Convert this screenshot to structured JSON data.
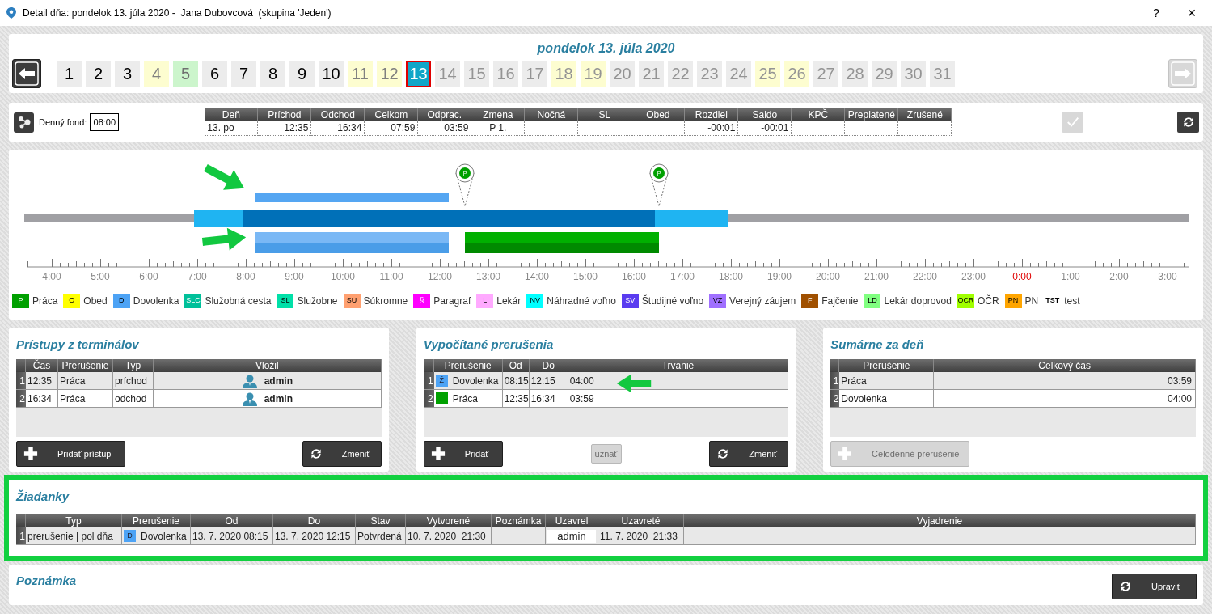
{
  "window": {
    "title": "Detail dňa: pondelok 13. júla 2020 -  Jana Dubovcová  (skupina 'Jeden')",
    "help": "?",
    "close": "×"
  },
  "date_heading": "pondelok 13. júla 2020",
  "nav": {
    "prev_disabled": false,
    "next_disabled": true
  },
  "days": [
    {
      "label": "1",
      "kind": "work",
      "future": false,
      "selected": false
    },
    {
      "label": "2",
      "kind": "work",
      "future": false,
      "selected": false
    },
    {
      "label": "3",
      "kind": "work",
      "future": false,
      "selected": false
    },
    {
      "label": "4",
      "kind": "weekend",
      "future": false,
      "selected": false
    },
    {
      "label": "5",
      "kind": "holiday",
      "future": false,
      "selected": false
    },
    {
      "label": "6",
      "kind": "work",
      "future": false,
      "selected": false
    },
    {
      "label": "7",
      "kind": "work",
      "future": false,
      "selected": false
    },
    {
      "label": "8",
      "kind": "work",
      "future": false,
      "selected": false
    },
    {
      "label": "9",
      "kind": "work",
      "future": false,
      "selected": false
    },
    {
      "label": "10",
      "kind": "work",
      "future": false,
      "selected": false
    },
    {
      "label": "11",
      "kind": "weekend",
      "future": false,
      "selected": false
    },
    {
      "label": "12",
      "kind": "weekend",
      "future": false,
      "selected": false
    },
    {
      "label": "13",
      "selected": true
    },
    {
      "label": "14",
      "kind": "work",
      "future": true,
      "selected": false
    },
    {
      "label": "15",
      "kind": "work",
      "future": true,
      "selected": false
    },
    {
      "label": "16",
      "kind": "work",
      "future": true,
      "selected": false
    },
    {
      "label": "17",
      "kind": "work",
      "future": true,
      "selected": false
    },
    {
      "label": "18",
      "kind": "weekend",
      "future": true,
      "selected": false
    },
    {
      "label": "19",
      "kind": "weekend",
      "future": true,
      "selected": false
    },
    {
      "label": "20",
      "kind": "work",
      "future": true,
      "selected": false
    },
    {
      "label": "21",
      "kind": "work",
      "future": true,
      "selected": false
    },
    {
      "label": "22",
      "kind": "work",
      "future": true,
      "selected": false
    },
    {
      "label": "23",
      "kind": "work",
      "future": true,
      "selected": false
    },
    {
      "label": "24",
      "kind": "work",
      "future": true,
      "selected": false
    },
    {
      "label": "25",
      "kind": "weekend",
      "future": true,
      "selected": false
    },
    {
      "label": "26",
      "kind": "weekend",
      "future": true,
      "selected": false
    },
    {
      "label": "27",
      "kind": "work",
      "future": true,
      "selected": false
    },
    {
      "label": "28",
      "kind": "work",
      "future": true,
      "selected": false
    },
    {
      "label": "29",
      "kind": "work",
      "future": true,
      "selected": false
    },
    {
      "label": "30",
      "kind": "work",
      "future": true,
      "selected": false
    },
    {
      "label": "31",
      "kind": "work",
      "future": true,
      "selected": false
    }
  ],
  "day_fund": {
    "label": "Denný fond:",
    "value": "08:00"
  },
  "summary": {
    "columns": [
      {
        "label": "Deň",
        "value": "13. po"
      },
      {
        "label": "Príchod",
        "value": "12:35"
      },
      {
        "label": "Odchod",
        "value": "16:34"
      },
      {
        "label": "Celkom",
        "value": "07:59"
      },
      {
        "label": "Odprac.",
        "value": "03:59"
      },
      {
        "label": "Zmena",
        "value": "P 1."
      },
      {
        "label": "Nočná"
      },
      {
        "label": "SL"
      },
      {
        "label": "Obed"
      },
      {
        "label": "Rozdiel",
        "value": "-00:01"
      },
      {
        "label": "Saldo",
        "value": "-00:01"
      },
      {
        "label": "KPČ"
      },
      {
        "label": "Preplatené"
      },
      {
        "label": "Zrušené"
      }
    ]
  },
  "confirm_button": {
    "disabled": true
  },
  "refresh_button": {
    "disabled": false
  },
  "timeline": {
    "pins": [
      {
        "code": "P"
      },
      {
        "code": "P"
      }
    ],
    "hours": [
      {
        "label": "4:00",
        "midnight": false
      },
      {
        "label": "5:00",
        "midnight": false
      },
      {
        "label": "6:00",
        "midnight": false
      },
      {
        "label": "7:00",
        "midnight": false
      },
      {
        "label": "8:00",
        "midnight": false
      },
      {
        "label": "9:00",
        "midnight": false
      },
      {
        "label": "10:00",
        "midnight": false
      },
      {
        "label": "11:00",
        "midnight": false
      },
      {
        "label": "12:00",
        "midnight": false
      },
      {
        "label": "13:00",
        "midnight": false
      },
      {
        "label": "14:00",
        "midnight": false
      },
      {
        "label": "15:00",
        "midnight": false
      },
      {
        "label": "16:00",
        "midnight": false
      },
      {
        "label": "17:00",
        "midnight": false
      },
      {
        "label": "18:00",
        "midnight": false
      },
      {
        "label": "19:00",
        "midnight": false
      },
      {
        "label": "20:00",
        "midnight": false
      },
      {
        "label": "21:00",
        "midnight": false
      },
      {
        "label": "22:00",
        "midnight": false
      },
      {
        "label": "23:00",
        "midnight": false
      },
      {
        "label": "0:00",
        "midnight": true
      },
      {
        "label": "1:00",
        "midnight": false
      },
      {
        "label": "2:00",
        "midnight": false
      },
      {
        "label": "3:00",
        "midnight": false
      }
    ]
  },
  "legend": [
    {
      "kind": "swatch",
      "code": "P",
      "label": "Práca",
      "color": "#00a000"
    },
    {
      "kind": "swatch",
      "code": "O",
      "label": "Obed",
      "color": "#ffff00"
    },
    {
      "kind": "swatch",
      "code": "D",
      "label": "Dovolenka",
      "color": "#4da3f5"
    },
    {
      "kind": "swatch",
      "code": "SLC",
      "label": "Služobná cesta",
      "color": "#00c09a"
    },
    {
      "kind": "swatch",
      "code": "SL",
      "label": "Služobne",
      "color": "#00e0a8"
    },
    {
      "kind": "swatch",
      "code": "SU",
      "label": "Súkromne",
      "color": "#ffa070"
    },
    {
      "kind": "swatch",
      "code": "§",
      "label": "Paragraf",
      "color": "#ff00ff"
    },
    {
      "kind": "swatch",
      "code": "L",
      "label": "Lekár",
      "color": "#ffaaff"
    },
    {
      "kind": "swatch",
      "code": "NV",
      "label": "Náhradné voľno",
      "color": "#00ffff"
    },
    {
      "kind": "swatch",
      "code": "SV",
      "label": "Študijné voľno",
      "color": "#5a3cf0"
    },
    {
      "kind": "swatch",
      "code": "VZ",
      "label": "Verejný záujem",
      "color": "#a070ff"
    },
    {
      "kind": "swatch",
      "code": "F",
      "label": "Fajčenie",
      "color": "#a05000"
    },
    {
      "kind": "swatch",
      "code": "LD",
      "label": "Lekár doprovod",
      "color": "#80ff80"
    },
    {
      "kind": "swatch",
      "code": "OCR",
      "label": "OČR",
      "color": "#a0ff00"
    },
    {
      "kind": "swatch",
      "code": "PN",
      "label": "PN",
      "color": "#ffa500"
    },
    {
      "kind": "text",
      "code": "TST",
      "label": "test"
    }
  ],
  "panels": [
    {
      "title": "Prístupy z terminálov",
      "columns": [
        "Čas",
        "Prerušenie",
        "Typ",
        "Vložil"
      ],
      "rows": [
        {
          "number": "1",
          "cells": [
            {
              "kind": "text",
              "text": "12:35"
            },
            {
              "kind": "text",
              "text": "Práca"
            },
            {
              "kind": "text",
              "text": "príchod"
            },
            {
              "kind": "user",
              "text": "admin"
            }
          ]
        },
        {
          "number": "2",
          "cells": [
            {
              "kind": "text",
              "text": "16:34"
            },
            {
              "kind": "text",
              "text": "Práca"
            },
            {
              "kind": "text",
              "text": "odchod"
            },
            {
              "kind": "user",
              "text": "admin"
            }
          ]
        }
      ],
      "buttons": [
        {
          "label": "Pridať prístup",
          "kind": "add",
          "disabled": false
        },
        {
          "label": "Zmeniť",
          "kind": "update",
          "disabled": false
        }
      ]
    },
    {
      "title": "Vypočítané prerušenia",
      "columns": [
        "Prerušenie",
        "Od",
        "Do",
        "Trvanie"
      ],
      "rows": [
        {
          "number": "1",
          "cells": [
            {
              "kind": "swatch",
              "code": "Ž",
              "color": "#4da3f5",
              "text": "Dovolenka"
            },
            {
              "kind": "text",
              "text": "08:15"
            },
            {
              "kind": "text",
              "text": "12:15"
            },
            {
              "kind": "text",
              "text": "04:00"
            }
          ]
        },
        {
          "number": "2",
          "cells": [
            {
              "kind": "swatch",
              "color": "#00a000",
              "text": "Práca"
            },
            {
              "kind": "text",
              "text": "12:35"
            },
            {
              "kind": "text",
              "text": "16:34"
            },
            {
              "kind": "text",
              "text": "03:59"
            }
          ]
        }
      ],
      "buttons": [
        {
          "label": "Pridať",
          "kind": "add",
          "disabled": false
        },
        {
          "label": "uznať",
          "kind": "plain",
          "disabled": true
        },
        {
          "label": "Zmeniť",
          "kind": "update",
          "disabled": false
        }
      ]
    },
    {
      "title": "Sumárne za deň",
      "columns": [
        "Prerušenie",
        "Celkový čas"
      ],
      "rows": [
        {
          "number": "1",
          "cells": [
            {
              "kind": "text",
              "text": "Práca"
            },
            {
              "kind": "text",
              "text": "03:59"
            }
          ]
        },
        {
          "number": "2",
          "cells": [
            {
              "kind": "text",
              "text": "Dovolenka"
            },
            {
              "kind": "text",
              "text": "04:00"
            }
          ]
        }
      ],
      "buttons": [
        {
          "label": "Celodenné prerušenie",
          "kind": "add",
          "disabled": true
        }
      ]
    }
  ],
  "requests": {
    "title": "Žiadanky",
    "highlighted": true,
    "columns": [
      "Typ",
      "Prerušenie",
      "Od",
      "Do",
      "Stav",
      "Vytvorené",
      "Poznámka",
      "Uzavrel",
      "Uzavreté",
      "Vyjadrenie"
    ],
    "rows": [
      {
        "number": "1",
        "cells": [
          {
            "kind": "text",
            "text": "prerušenie | pol dňa"
          },
          {
            "kind": "swatch",
            "code": "D",
            "color": "#4da3f5",
            "text": "Dovolenka"
          },
          {
            "kind": "text",
            "text": "13. 7. 2020 08:15"
          },
          {
            "kind": "text",
            "text": "13. 7. 2020 12:15"
          },
          {
            "kind": "text",
            "text": "Potvrdená"
          },
          {
            "kind": "text",
            "text": "10. 7. 2020  21:30"
          },
          {
            "kind": "empty"
          },
          {
            "kind": "boxed",
            "text": "admin"
          },
          {
            "kind": "text",
            "text": "11. 7. 2020  21:33"
          },
          {
            "kind": "empty"
          }
        ]
      }
    ]
  },
  "note": {
    "title": "Poznámka",
    "button": {
      "label": "Upraviť",
      "kind": "update",
      "disabled": false
    }
  }
}
